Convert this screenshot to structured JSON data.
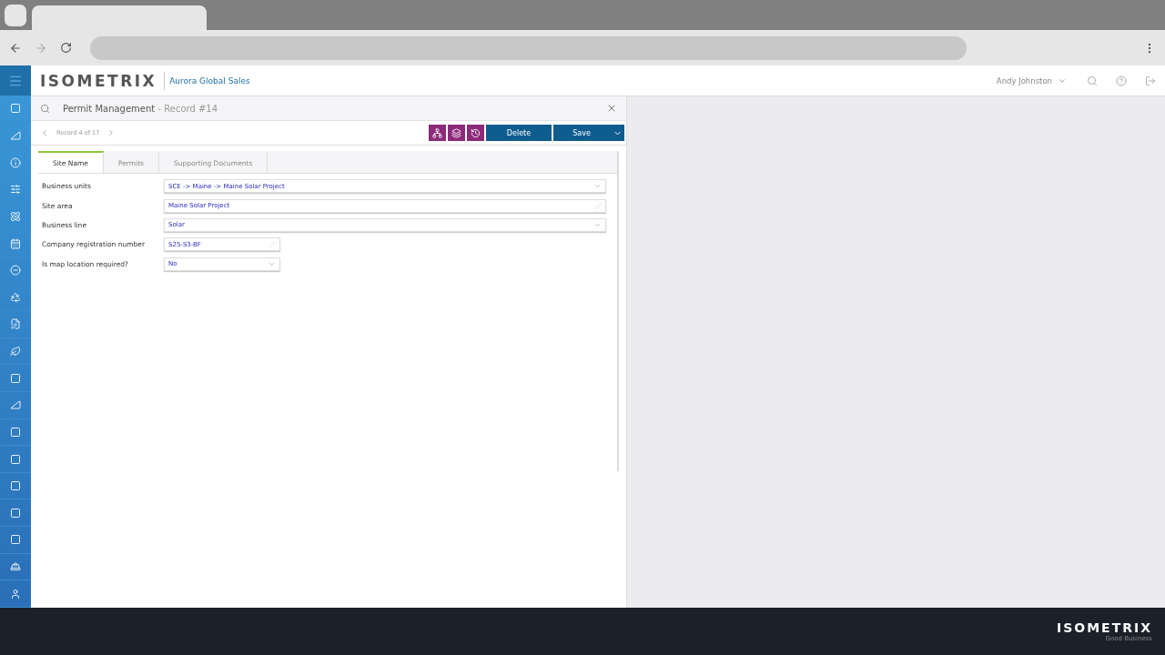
{
  "app": {
    "logo": "ISOMETRIX",
    "company": "Aurora Global Sales",
    "user": "Andy Johnston"
  },
  "record": {
    "title": "Permit Management",
    "subtitle": " - Record #14",
    "position": "Record 4 of 17"
  },
  "actions": [
    {
      "label": "Delete"
    },
    {
      "label": "Save"
    }
  ],
  "tabs": [
    {
      "label": "Site Name",
      "selected": true
    },
    {
      "label": "Permits",
      "selected": false
    },
    {
      "label": "Supporting Documents",
      "selected": false
    }
  ],
  "fields": [
    {
      "label": "Business units",
      "value": "SCE -> Maine -> Maine Solar Project",
      "kind": "select"
    },
    {
      "label": "Site area",
      "value": "Maine Solar Project",
      "kind": "text"
    },
    {
      "label": "Business line",
      "value": "Solar",
      "kind": "select"
    },
    {
      "label": "Company registration number",
      "value": "S25-S3-BF",
      "kind": "text"
    },
    {
      "label": "Is map location required?",
      "value": "No",
      "kind": "select"
    }
  ],
  "footer": {
    "logo": "ISOMETRIX",
    "tagline": "Good Business"
  }
}
